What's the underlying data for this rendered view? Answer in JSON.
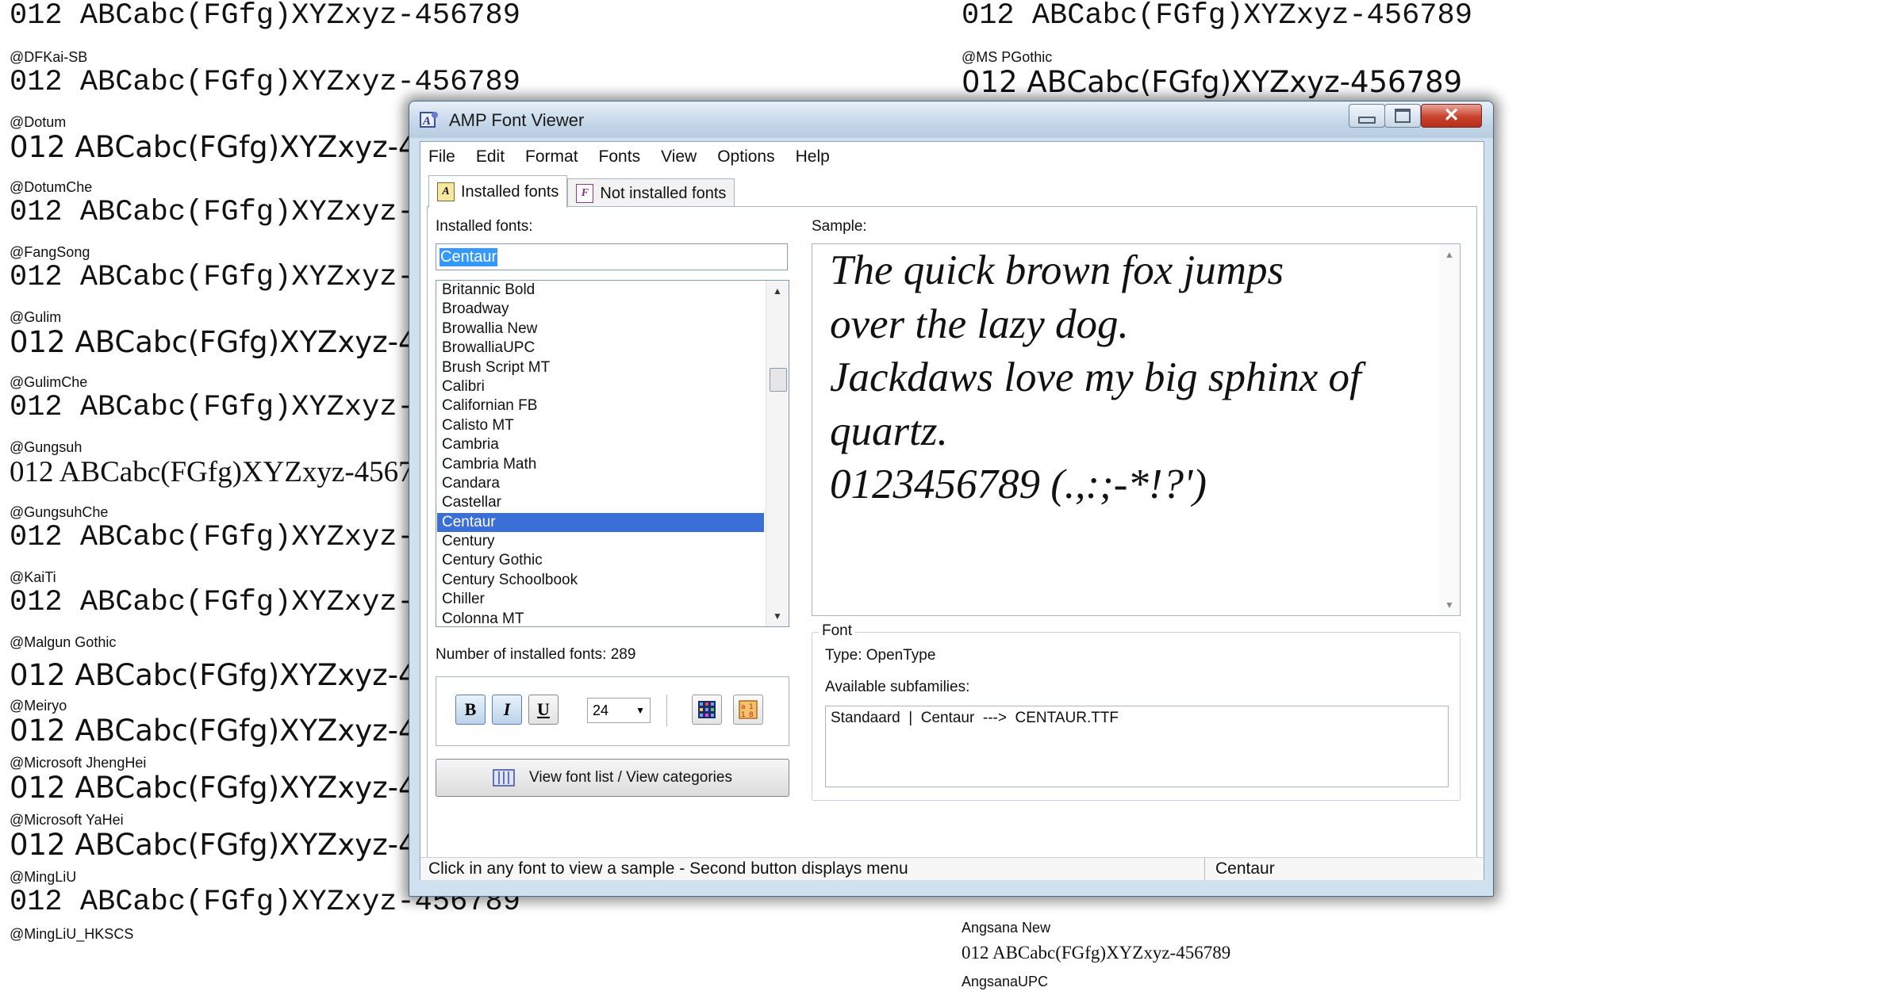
{
  "background": {
    "left": [
      {
        "name": "",
        "sample": "012 ABCabc(FGfg)XYZxyz-456789",
        "style": "mono"
      },
      {
        "name": "@DFKai-SB",
        "sample": "012 ABCabc(FGfg)XYZxyz-456789",
        "style": "mono"
      },
      {
        "name": "@Dotum",
        "sample": "012 ABCabc(FGfg)XYZxyz-456789",
        "style": "sans"
      },
      {
        "name": "@DotumChe",
        "sample": "012 ABCabc(FGfg)XYZxyz-456789",
        "style": "mono"
      },
      {
        "name": "@FangSong",
        "sample": "012 ABCabc(FGfg)XYZxyz-456789",
        "style": "mono"
      },
      {
        "name": "@Gulim",
        "sample": "012 ABCabc(FGfg)XYZxyz-456789",
        "style": "sans"
      },
      {
        "name": "@GulimChe",
        "sample": "012 ABCabc(FGfg)XYZxyz-456789",
        "style": "mono"
      },
      {
        "name": "@Gungsuh",
        "sample": "012 ABCabc(FGfg)XYZxyz-456789",
        "style": "serif"
      },
      {
        "name": "@GungsuhChe",
        "sample": "012 ABCabc(FGfg)XYZxyz-456789",
        "style": "mono"
      },
      {
        "name": "@KaiTi",
        "sample": "012 ABCabc(FGfg)XYZxyz-456789",
        "style": "mono"
      },
      {
        "name": "@Malgun Gothic",
        "sample": "012 ABCabc(FGfg)XYZxyz-456789",
        "style": "sans"
      },
      {
        "name": "@Meiryo",
        "sample": "012 ABCabc(FGfg)XYZxyz-456789",
        "style": "sans"
      },
      {
        "name": "@Microsoft JhengHei",
        "sample": "012 ABCabc(FGfg)XYZxyz-456789",
        "style": "sans"
      },
      {
        "name": "@Microsoft YaHei",
        "sample": "012 ABCabc(FGfg)XYZxyz-456789",
        "style": "sans"
      },
      {
        "name": "@MingLiU",
        "sample": "012 ABCabc(FGfg)XYZxyz-456789",
        "style": "mono"
      },
      {
        "name": "@MingLiU_HKSCS",
        "sample": "",
        "style": "mono"
      }
    ],
    "right": [
      {
        "name": "",
        "sample": "012 ABCabc(FGfg)XYZxyz-456789",
        "style": "mono"
      },
      {
        "name": "@MS PGothic",
        "sample": "012 ABCabc(FGfg)XYZxyz-456789",
        "style": "sans"
      },
      {
        "name": "Angsana New",
        "sample": "012 ABCabc(FGfg)XYZxyz-456789",
        "style": "serif-small"
      },
      {
        "name": "AngsanaUPC",
        "sample": "",
        "style": "serif-small"
      }
    ]
  },
  "window": {
    "title": "AMP Font Viewer",
    "close_label": "✕",
    "menu": [
      "File",
      "Edit",
      "Format",
      "Fonts",
      "View",
      "Options",
      "Help"
    ],
    "tabs": {
      "installed": "Installed fonts",
      "not_installed": "Not installed fonts"
    },
    "installed_label": "Installed fonts:",
    "search_value": "Centaur",
    "font_list": [
      "Britannic Bold",
      "Broadway",
      "Browallia New",
      "BrowalliaUPC",
      "Brush Script MT",
      "Calibri",
      "Californian FB",
      "Calisto MT",
      "Cambria",
      "Cambria Math",
      "Candara",
      "Castellar",
      "Centaur",
      "Century",
      "Century Gothic",
      "Century Schoolbook",
      "Chiller",
      "Colonna MT"
    ],
    "selected_font": "Centaur",
    "count_text": "Number of installed fonts:  289",
    "format": {
      "bold": "B",
      "italic": "I",
      "underline": "U",
      "size": "24"
    },
    "view_button": "View font list / View categories",
    "sample_label": "Sample:",
    "sample_lines": [
      "The quick brown fox jumps",
      "over the lazy dog.",
      "Jackdaws love my big sphinx of",
      "quartz.",
      "0123456789 (.,:;-*!?')"
    ],
    "font_group": "Font",
    "type_text": "Type:  OpenType",
    "subfamilies_label": "Available subfamilies:",
    "subfamily_entry": "Standaard  |  Centaur  --->  CENTAUR.TTF",
    "status_left": "Click in any font to view a sample - Second button displays menu",
    "status_right": "Centaur"
  }
}
